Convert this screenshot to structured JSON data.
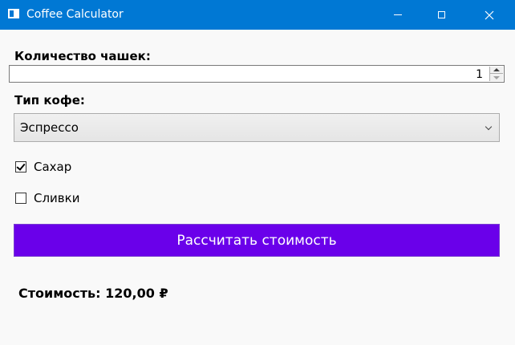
{
  "window": {
    "title": "Coffee Calculator",
    "icon": "app-window-icon",
    "titlebar_color": "#0078d4",
    "controls": [
      "minimize",
      "maximize",
      "close"
    ]
  },
  "form": {
    "cups_label": "Количество чашек:",
    "cups_value": "1",
    "type_label": "Тип кофе:",
    "type_selected": "Эспрессо",
    "sugar_label": "Сахар",
    "sugar_checked": true,
    "cream_label": "Сливки",
    "cream_checked": false,
    "calculate_button": "Рассчитать стоимость",
    "button_color": "#6a00ea"
  },
  "result": {
    "text": "Стоимость: 120,00 ₽"
  }
}
